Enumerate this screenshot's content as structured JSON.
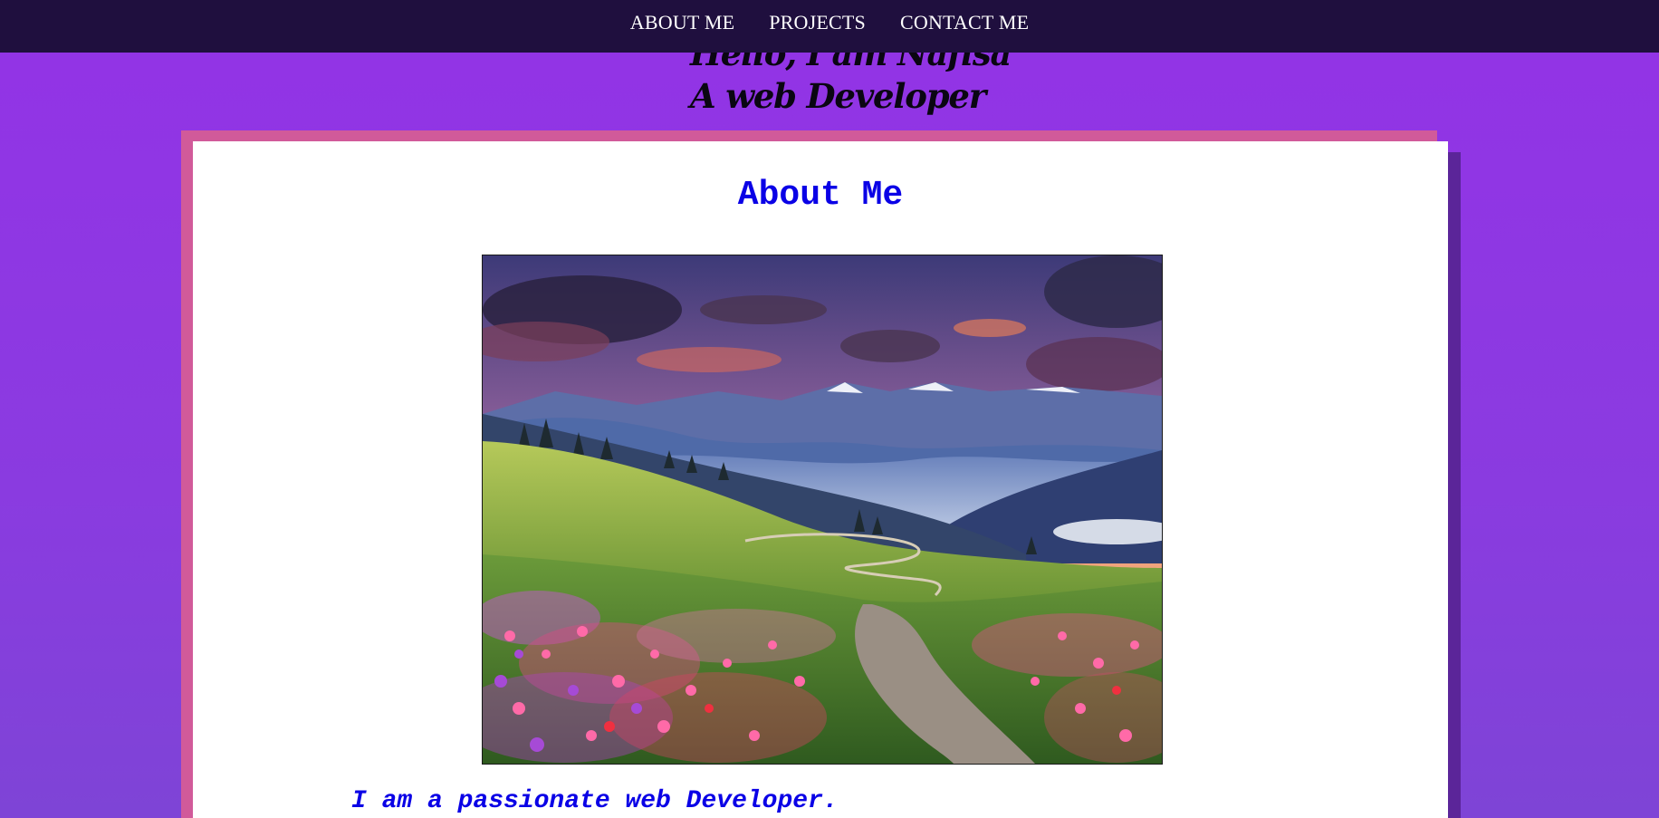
{
  "nav": {
    "items": [
      {
        "label": "ABOUT ME"
      },
      {
        "label": "PROJECTS"
      },
      {
        "label": "CONTACT ME"
      }
    ]
  },
  "hero": {
    "greeting": "Hello, I am Nafisa",
    "role": "A web Developer"
  },
  "about": {
    "title": "About Me",
    "intro": "I am a passionate web Developer."
  },
  "colors": {
    "background": "#9333e6",
    "navbar": "#1f0f3e",
    "card_border": "#d15a9a",
    "card_shadow": "#5b2599",
    "heading_blue": "#0a00e6"
  }
}
